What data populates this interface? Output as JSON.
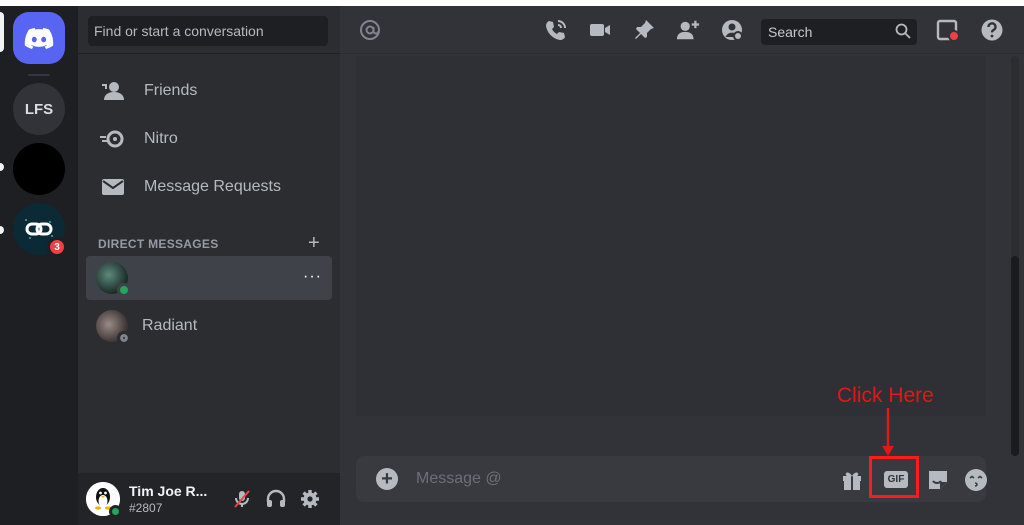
{
  "servers": {
    "lfs_label": "LFS",
    "logo_badge": "3"
  },
  "sidebar": {
    "search_placeholder": "Find or start a conversation",
    "nav": {
      "friends": "Friends",
      "nitro": "Nitro",
      "message_requests": "Message Requests"
    },
    "dm_header": "DIRECT MESSAGES",
    "dm_add": "+",
    "dms": [
      {
        "name": "",
        "status": "online",
        "more": "···"
      },
      {
        "name": "Radiant",
        "status": "offline"
      }
    ]
  },
  "user": {
    "name": "Tim Joe R...",
    "tag": "#2807",
    "status": "online"
  },
  "header": {
    "search_placeholder": "Search"
  },
  "composer": {
    "placeholder": "Message @",
    "gif_label": "GIF"
  },
  "annotation": {
    "text": "Click Here"
  },
  "colors": {
    "blurple": "#5865f2",
    "online": "#23a55a",
    "offline": "#80848e",
    "alert": "#f23f43",
    "annotation": "#e31717"
  },
  "icons": [
    "mention-icon",
    "voice-call-icon",
    "video-call-icon",
    "pin-icon",
    "add-friend-icon",
    "user-profile-icon",
    "search-icon",
    "inbox-icon",
    "help-icon",
    "add-attachment-icon",
    "gift-icon",
    "gif-icon",
    "sticker-icon",
    "emoji-icon",
    "mute-icon",
    "deafen-icon",
    "settings-icon"
  ]
}
